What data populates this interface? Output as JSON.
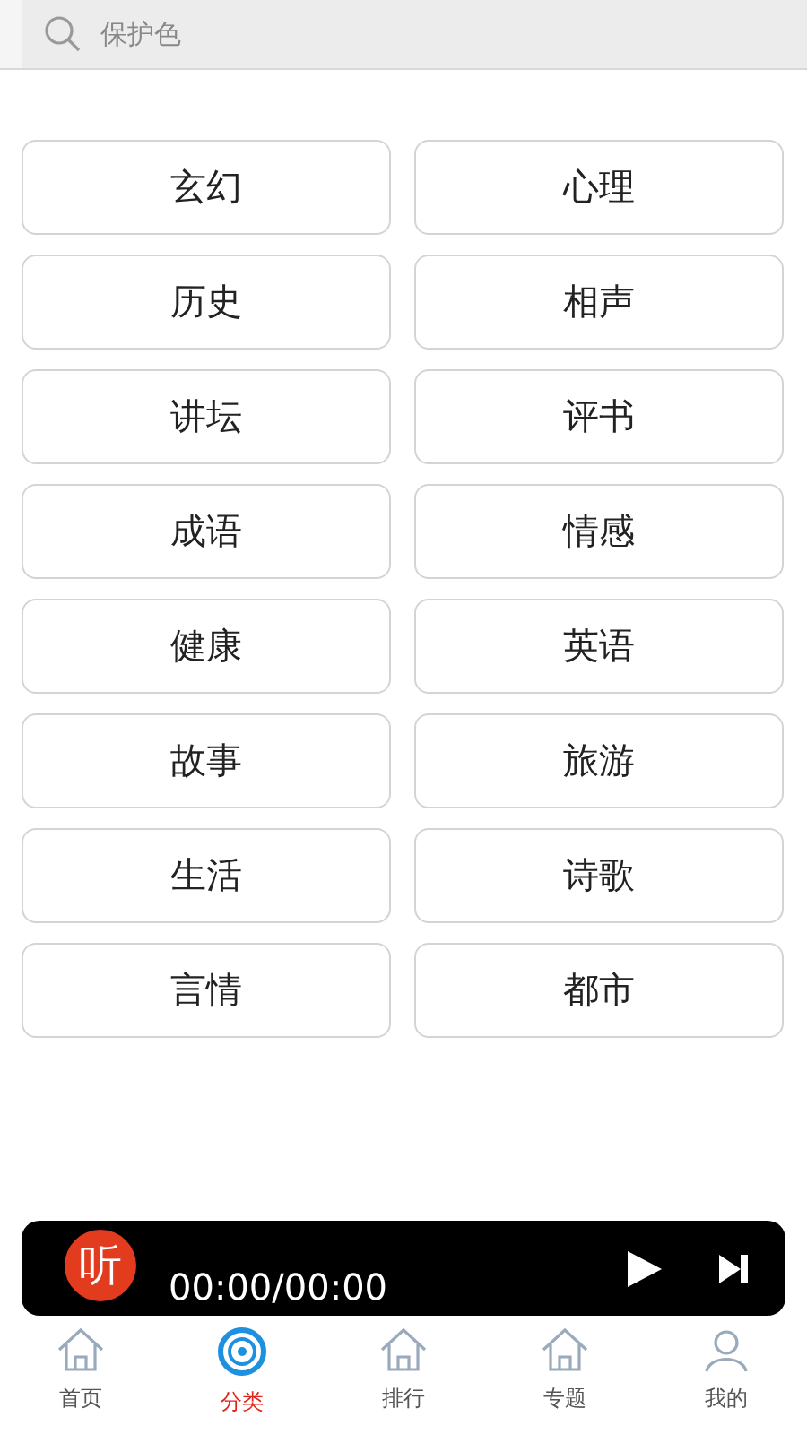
{
  "search": {
    "placeholder": "保护色"
  },
  "categories": [
    "玄幻",
    "心理",
    "历史",
    "相声",
    "讲坛",
    "评书",
    "成语",
    "情感",
    "健康",
    "英语",
    "故事",
    "旅游",
    "生活",
    "诗歌",
    "言情",
    "都市"
  ],
  "player": {
    "logo": "听",
    "time": "00:00/00:00"
  },
  "nav": [
    {
      "label": "首页",
      "kind": "home",
      "selected": false
    },
    {
      "label": "分类",
      "kind": "disc",
      "selected": true
    },
    {
      "label": "排行",
      "kind": "home",
      "selected": false
    },
    {
      "label": "专题",
      "kind": "home",
      "selected": false
    },
    {
      "label": "我的",
      "kind": "person",
      "selected": false
    }
  ]
}
